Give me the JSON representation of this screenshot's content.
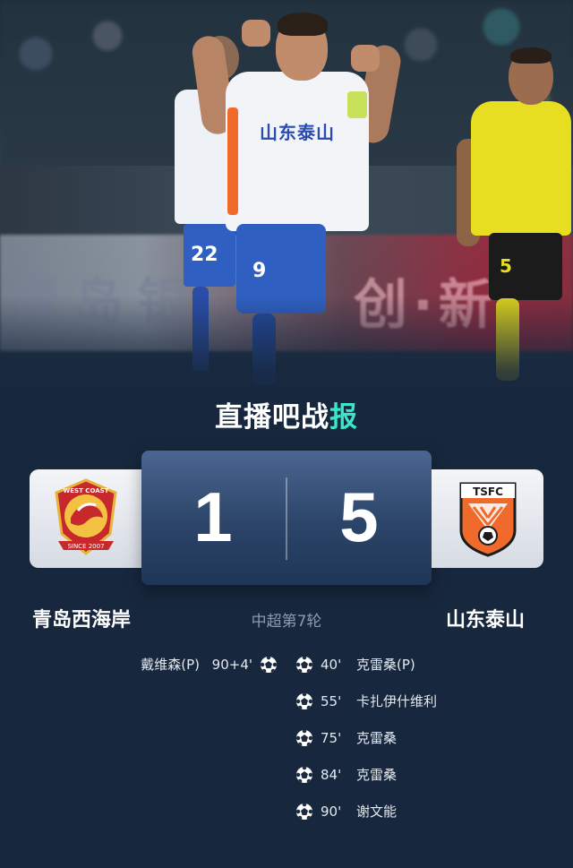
{
  "brand": {
    "prefix": "直播吧战",
    "suffix": "报"
  },
  "match": {
    "competition_round": "中超第7轮",
    "home": {
      "name": "青岛西海岸",
      "score": "1",
      "logo_icon": "west-coast-fc-crest-icon"
    },
    "away": {
      "name": "山东泰山",
      "score": "5",
      "logo_icon": "shandong-taishan-crest-icon"
    }
  },
  "hero": {
    "jersey_sponsor": "山东泰山",
    "back_player_number": "22",
    "main_player_number": "9",
    "right_player_number": "5",
    "ad_left": "青岛银",
    "ad_right": "创·新"
  },
  "logos": {
    "home_ring_top": "WEST COAST",
    "home_ring_bottom": "SINCE 2007",
    "away_initials": "TSFC"
  },
  "goals": {
    "home": [
      {
        "player": "戴维森(P)",
        "minute": "90+4'"
      }
    ],
    "away": [
      {
        "player": "克雷桑(P)",
        "minute": "40'"
      },
      {
        "player": "卡扎伊什维利",
        "minute": "55'"
      },
      {
        "player": "克雷桑",
        "minute": "75'"
      },
      {
        "player": "克雷桑",
        "minute": "84'"
      },
      {
        "player": "谢文能",
        "minute": "90'"
      }
    ]
  },
  "colors": {
    "background": "#17273d",
    "accent": "#39e6c7",
    "home_kit": "#2f5fc1",
    "away_kit": "#e7de21"
  }
}
